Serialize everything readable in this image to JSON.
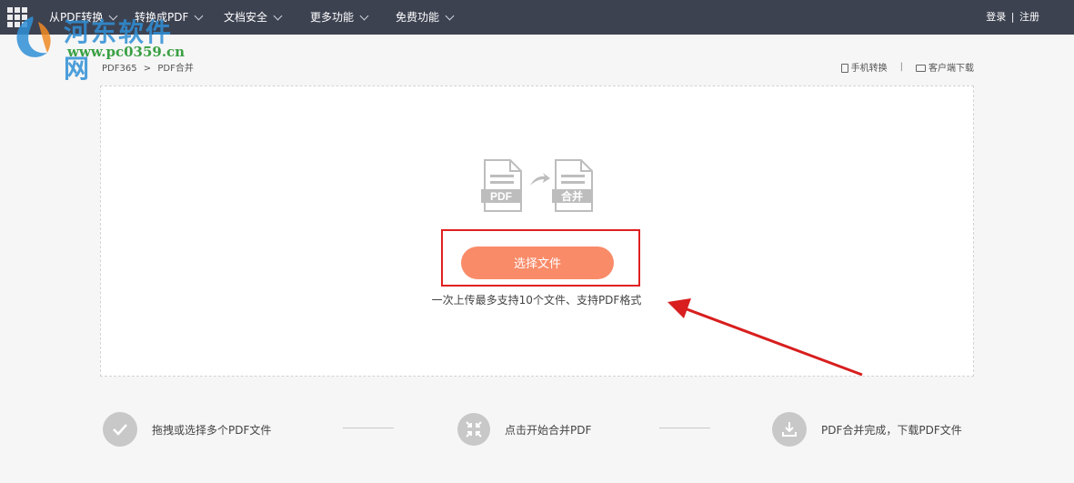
{
  "nav": {
    "items": [
      {
        "label": "从PDF转换"
      },
      {
        "label": "转换成PDF"
      },
      {
        "label": "文档安全"
      },
      {
        "label": "更多功能"
      },
      {
        "label": "免费功能"
      }
    ],
    "login": "登录",
    "divider": "|",
    "register": "注册"
  },
  "watermark": {
    "title": "河东软件网",
    "url": "www.pc0359.cn"
  },
  "breadcrumb": {
    "home": "PDF365",
    "separator": ">",
    "current": "PDF合并"
  },
  "toplinks": {
    "mobile": "手机转换",
    "divider": "|",
    "client": "客户端下载"
  },
  "upload": {
    "source_badge": "PDF",
    "target_badge": "合并",
    "select_button": "选择文件",
    "hint": "一次上传最多支持10个文件、支持PDF格式"
  },
  "steps": [
    {
      "text": "拖拽或选择多个PDF文件",
      "icon": "check-icon"
    },
    {
      "text": "点击开始合并PDF",
      "icon": "merge-arrows-icon"
    },
    {
      "text": "PDF合并完成，下载PDF文件",
      "icon": "download-icon"
    }
  ],
  "colors": {
    "topbar": "#3d4251",
    "accent": "#f98b69",
    "highlight": "#e02020",
    "step_icon": "#c8c8c8"
  }
}
